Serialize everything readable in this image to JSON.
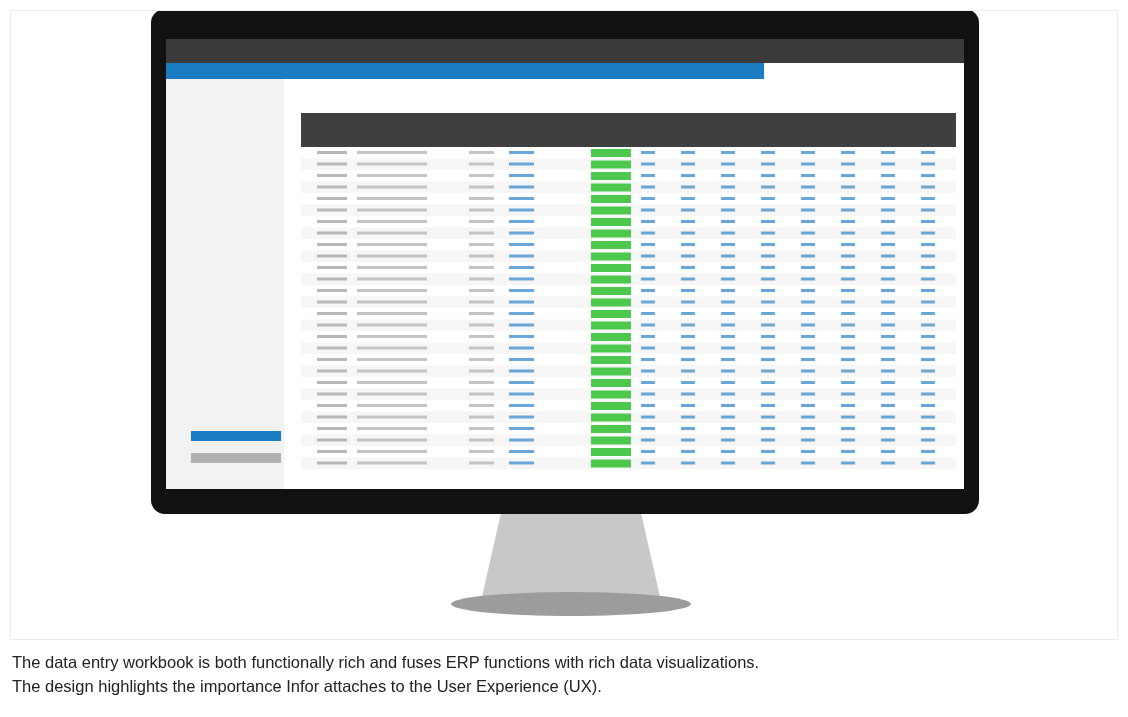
{
  "caption": [
    "The data entry workbook is both functionally rich and fuses ERP functions with rich data visualizations.",
    "The design highlights the importance Infor attaches to the User Experience (UX)."
  ]
}
